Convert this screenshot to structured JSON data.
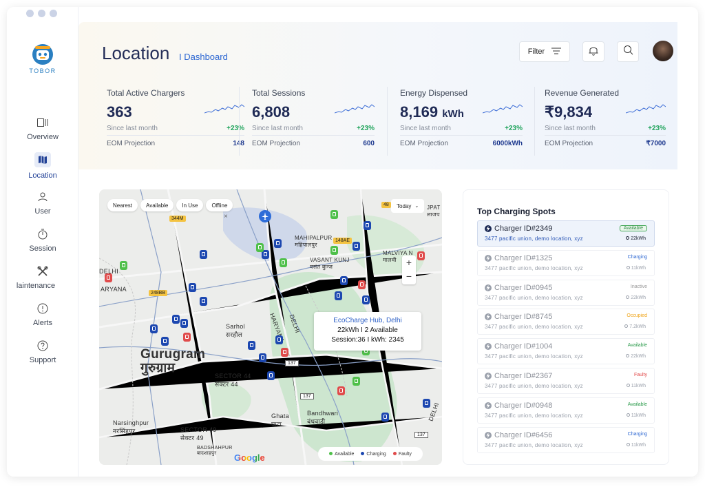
{
  "app": {
    "logo_text": "TOBOR"
  },
  "sidebar": {
    "items": [
      {
        "label": "Overview",
        "icon": "overview-icon"
      },
      {
        "label": "Location",
        "icon": "map-icon",
        "active": true
      },
      {
        "label": "User",
        "icon": "user-icon"
      },
      {
        "label": "Session",
        "icon": "timer-icon"
      },
      {
        "label": "laintenance",
        "icon": "tools-icon"
      },
      {
        "label": "Alerts",
        "icon": "alert-icon"
      },
      {
        "label": "Support",
        "icon": "help-icon"
      }
    ]
  },
  "header": {
    "title": "Location",
    "subtitle": "I Dashboard",
    "filter_label": "Filter"
  },
  "stats": [
    {
      "title": "Total Active Chargers",
      "value": "363",
      "unit": "",
      "since": "Since last month",
      "change": "+23%",
      "proj_label": "EOM Projection",
      "proj_value": "148"
    },
    {
      "title": "Total Sessions",
      "value": "6,808",
      "unit": "",
      "since": "Since last month",
      "change": "+23%",
      "proj_label": "EOM Projection",
      "proj_value": "600"
    },
    {
      "title": "Energy Dispensed",
      "value": "8,169",
      "unit": "kWh",
      "since": "Since last month",
      "change": "+23%",
      "proj_label": "EOM Projection",
      "proj_value": "6000kWh"
    },
    {
      "title": "Revenue Generated",
      "value": "₹9,834",
      "unit": "",
      "since": "Since last month",
      "change": "+23%",
      "proj_label": "EOM Projection",
      "proj_value": "₹7000"
    }
  ],
  "map": {
    "chips": [
      "Nearest",
      "Available",
      "In Use",
      "Offline"
    ],
    "period": "Today",
    "zoom_in": "+",
    "zoom_out": "−",
    "close": "×",
    "callout": {
      "title": "EcoCharge Hub, Delhi",
      "line1": "22kWh I 2 Available",
      "line2": "Session:36 I kWh: 2345"
    },
    "legend": {
      "available": "Available",
      "charging": "Charging",
      "faulty": "Faulty"
    },
    "labels": {
      "city": "Gurugram",
      "city_hi": "गुरुग्राम",
      "mahipalpur": "MAHIPALPUR",
      "mahipalpur_hi": "महिपालपुर",
      "vasant": "VASANT KUNJ",
      "vasant_hi": "वसंत कुन्ज",
      "malviya": "MALVIYA N",
      "malviya_hi": "मालवी",
      "sarhol": "Sarhol",
      "sarhol_hi": "सरहौल",
      "sector44": "SECTOR 44",
      "sector44_hi": "सेक्टर 44",
      "ghata": "Ghata",
      "ghata_hi": "घाटा",
      "bandhwari": "Bandhwari",
      "bandhwari_hi": "बंधवाड़ी",
      "narsinghpur": "Narsinghpur",
      "narsinghpur_hi": "नरसिंहपुर",
      "sector49": "SECTOR 49",
      "sector49_hi": "सेक्टर 49",
      "badshahpur": "BADSHAHPUR",
      "badshahpur_hi": "बादशाहपुर",
      "haryana": "HARYANA",
      "haryana2": "ARYANA",
      "delhi": "DELHI",
      "delhi2": "DELHI",
      "delhi3": "DELHI",
      "jpat": "JPAT",
      "jpat_hi": "लाजप",
      "sa": "SA"
    },
    "road_badges": [
      "344M",
      "48",
      "148AE",
      "248BB"
    ],
    "route_badges": [
      "137",
      "137",
      "137"
    ],
    "google": "Google"
  },
  "top_spots": {
    "title": "Top Charging Spots",
    "items": [
      {
        "name": "Charger ID#2349",
        "address": "3477 pacific union, demo location, xyz",
        "status": "Available",
        "kwh": "22kWh",
        "status_class": "available"
      },
      {
        "name": "Charger ID#1325",
        "address": "3477 pacific union, demo location, xyz",
        "status": "Charging",
        "kwh": "11kWh",
        "status_class": "charging"
      },
      {
        "name": "Charger ID#0945",
        "address": "3477 pacific union, demo location, xyz",
        "status": "Inactive",
        "kwh": "22kWh",
        "status_class": "inactive"
      },
      {
        "name": "Charger ID#8745",
        "address": "3477 pacific union, demo location, xyz",
        "status": "Occupied",
        "kwh": "7.2kWh",
        "status_class": "occupied"
      },
      {
        "name": "Charger ID#1004",
        "address": "3477 pacific union, demo location, xyz",
        "status": "Available",
        "kwh": "22kWh",
        "status_class": "available"
      },
      {
        "name": "Charger ID#2367",
        "address": "3477 pacific union, demo location, xyz",
        "status": "Faulty",
        "kwh": "11kWh",
        "status_class": "faulty"
      },
      {
        "name": "Charger ID#0948",
        "address": "3477 pacific union, demo location, xyz",
        "status": "Available",
        "kwh": "11kWh",
        "status_class": "available"
      },
      {
        "name": "Charger ID#6456",
        "address": "3477 pacific union, demo location, xyz",
        "status": "Charging",
        "kwh": "11kWh",
        "status_class": "charging"
      }
    ]
  },
  "colors": {
    "brand_navy": "#232d57",
    "accent_blue": "#2b66d2",
    "positive_green": "#1fa35b",
    "pin_blue": "#1c47b0",
    "pin_green": "#4fc04a",
    "pin_red": "#e04b4b"
  }
}
